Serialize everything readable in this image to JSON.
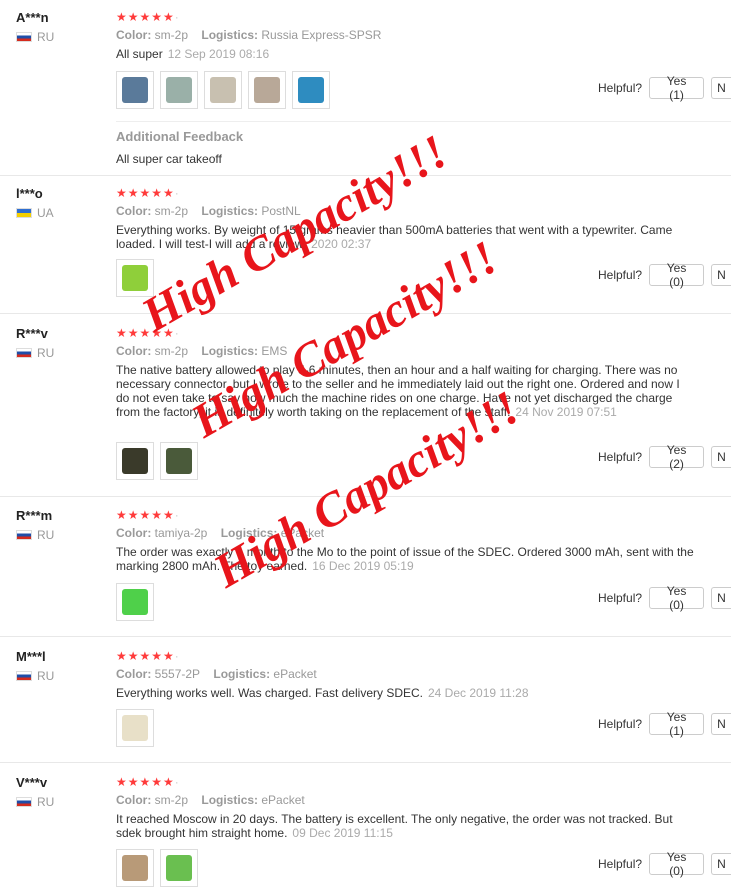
{
  "ui": {
    "helpful_label": "Helpful?",
    "no_label": "N",
    "stars": "★★★★★",
    "color_label": "Color:",
    "logistics_label": "Logistics:"
  },
  "overlay_text": "High Capacity!!!",
  "reviews": [
    {
      "user": "A***n",
      "country": "RU",
      "color": "sm-2p",
      "logistics": "Russia Express-SPSR",
      "text": "All super",
      "date": "12 Sep 2019 08:16",
      "yes": "Yes (1)",
      "additional_title": "Additional Feedback",
      "additional_text": "All super car takeoff"
    },
    {
      "user": "l***o",
      "country": "UA",
      "color": "sm-2p",
      "logistics": "PostNL",
      "text": "Everything works. By weight of 15 grams heavier than 500mA batteries that went with a typewriter. Came loaded. I will test-I will add a review.",
      "date": "2020 02:37",
      "yes": "Yes (0)"
    },
    {
      "user": "R***v",
      "country": "RU",
      "color": "sm-2p",
      "logistics": "EMS",
      "text": "The native battery allowed to play 5-6 minutes, then an hour and a half waiting for charging. There was no necessary connector, but I wrote to the seller and he immediately laid out the right one. Ordered and now I do not even take to say how much the machine rides on one charge. Have not yet discharged the charge from the factory, it is definitely worth taking on the replacement of the staff.",
      "date": "24 Nov 2019 07:51",
      "yes": "Yes (2)"
    },
    {
      "user": "R***m",
      "country": "RU",
      "color": "tamiya-2p",
      "logistics": "ePacket",
      "text": "The order was exactly a month to the Mo to the point of issue of the SDEC. Ordered 3000 mAh, sent with the marking 2800 mAh. The toy earned.",
      "date": "16 Dec 2019 05:19",
      "yes": "Yes (0)"
    },
    {
      "user": "M***l",
      "country": "RU",
      "color": "5557-2P",
      "logistics": "ePacket",
      "text": "Everything works well. Was charged. Fast delivery SDEC.",
      "date": "24 Dec 2019 11:28",
      "yes": "Yes (1)"
    },
    {
      "user": "V***v",
      "country": "RU",
      "color": "sm-2p",
      "logistics": "ePacket",
      "text": "It reached Moscow in 20 days. The battery is excellent. The only negative, the order was not tracked. But sdek brought him straight home.",
      "date": "09 Dec 2019 11:15",
      "yes": "Yes (0)"
    }
  ]
}
